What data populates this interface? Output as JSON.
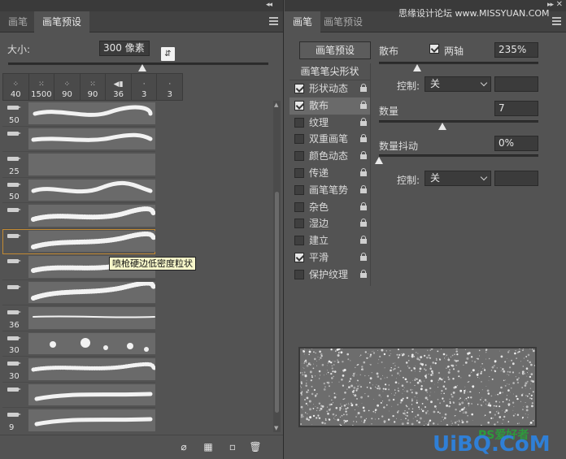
{
  "left": {
    "tabs": [
      {
        "label": "画笔"
      },
      {
        "label": "画笔预设"
      }
    ],
    "size_label": "大小:",
    "size_value": "300 像素",
    "size_slider_fraction": 0.52,
    "presets": [
      {
        "value": "40"
      },
      {
        "value": "1500"
      },
      {
        "value": "90"
      },
      {
        "value": "90"
      },
      {
        "value": "36"
      },
      {
        "value": "3"
      },
      {
        "value": "3"
      }
    ],
    "brushes": [
      {
        "size": "50"
      },
      {
        "size": ""
      },
      {
        "size": "25"
      },
      {
        "size": "50"
      },
      {
        "size": ""
      },
      {
        "size": ""
      },
      {
        "size": ""
      },
      {
        "size": ""
      },
      {
        "size": "36"
      },
      {
        "size": "30"
      },
      {
        "size": "30"
      },
      {
        "size": ""
      },
      {
        "size": "9"
      }
    ],
    "selected_brush_index": 5,
    "tooltip": "喷枪硬边低密度粒状"
  },
  "right": {
    "tabs": [
      {
        "label": "画笔"
      },
      {
        "label": "画笔预设"
      }
    ],
    "preset_button": "画笔预设",
    "options_header": "画笔笔尖形状",
    "options": [
      {
        "label": "形状动态",
        "checked": true
      },
      {
        "label": "散布",
        "checked": true
      },
      {
        "label": "纹理",
        "checked": false
      },
      {
        "label": "双重画笔",
        "checked": false
      },
      {
        "label": "颜色动态",
        "checked": false
      },
      {
        "label": "传递",
        "checked": false
      },
      {
        "label": "画笔笔势",
        "checked": false
      },
      {
        "label": "杂色",
        "checked": false
      },
      {
        "label": "湿边",
        "checked": false
      },
      {
        "label": "建立",
        "checked": false
      },
      {
        "label": "平滑",
        "checked": true
      },
      {
        "label": "保护纹理",
        "checked": false
      }
    ],
    "active_option_index": 1,
    "scatter_label": "散布",
    "both_axes_label": "两轴",
    "scatter_value": "235%",
    "control_label": "控制:",
    "control_value": "关",
    "count_label": "数量",
    "count_value": "7",
    "count_jitter_label": "数量抖动",
    "count_jitter_value": "0%",
    "control2_label": "控制:",
    "control2_value": "关"
  },
  "watermarks": {
    "top": "思缘设计论坛 www.MISSYUAN.COM",
    "ps": "PS爱好者",
    "site": "UiBQ.CoM"
  }
}
